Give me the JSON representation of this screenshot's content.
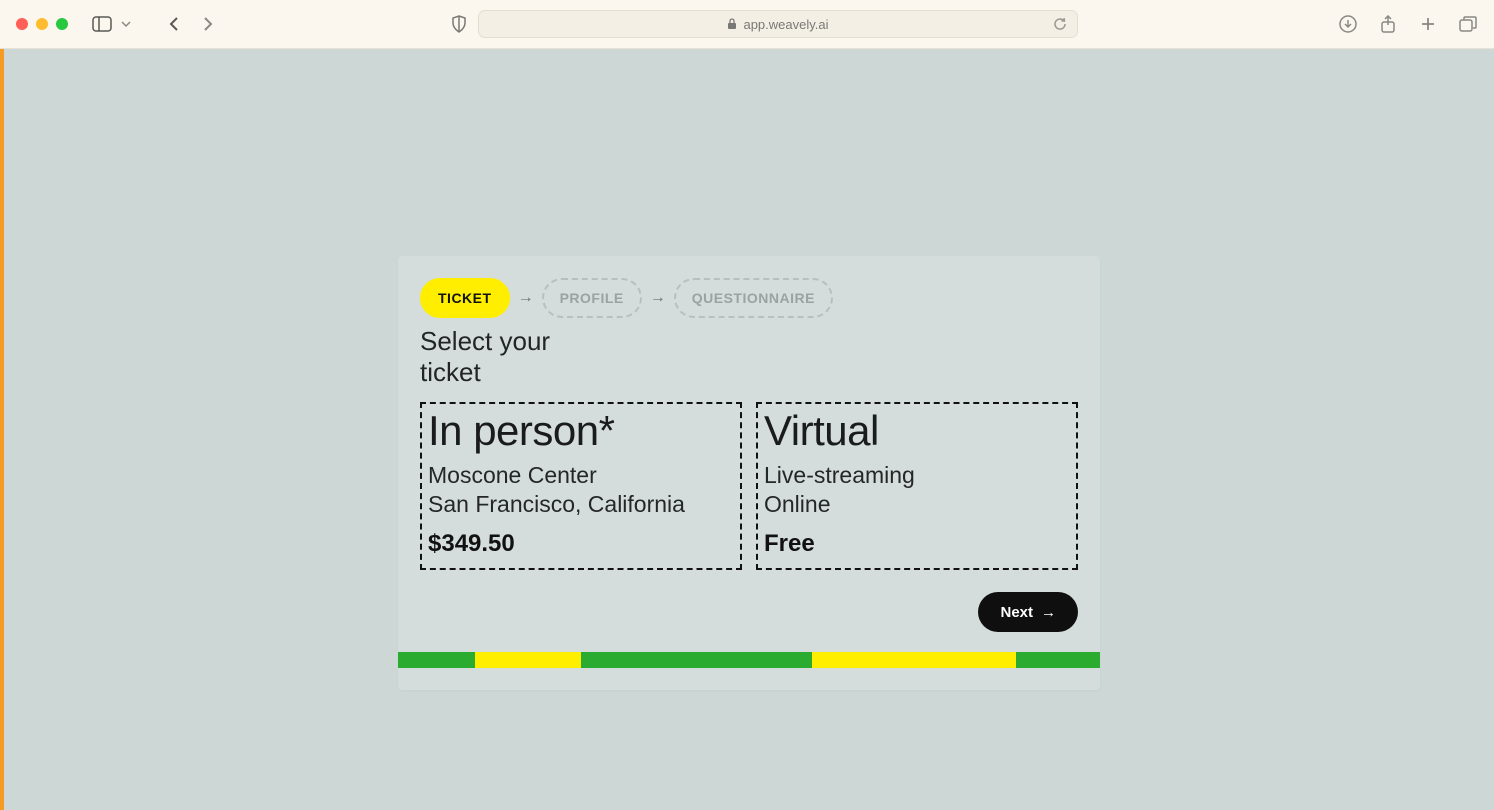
{
  "browser": {
    "url_host": "app.weavely.ai"
  },
  "stepper": {
    "steps": [
      {
        "label": "TICKET",
        "active": true
      },
      {
        "label": "PROFILE",
        "active": false
      },
      {
        "label": "QUESTIONNAIRE",
        "active": false
      }
    ]
  },
  "section": {
    "title": "Select your ticket"
  },
  "tickets": [
    {
      "title": "In person*",
      "desc": "Moscone Center\nSan Francisco, California",
      "price": "$349.50"
    },
    {
      "title": "Virtual",
      "desc": "Live-streaming\nOnline",
      "price": "Free"
    }
  ],
  "actions": {
    "next_label": "Next"
  },
  "progress": {
    "segments": [
      {
        "color": "#2bab2f",
        "pct": 11
      },
      {
        "color": "#ffee00",
        "pct": 15
      },
      {
        "color": "#2bab2f",
        "pct": 33
      },
      {
        "color": "#ffee00",
        "pct": 29
      },
      {
        "color": "#2bab2f",
        "pct": 12
      }
    ]
  }
}
